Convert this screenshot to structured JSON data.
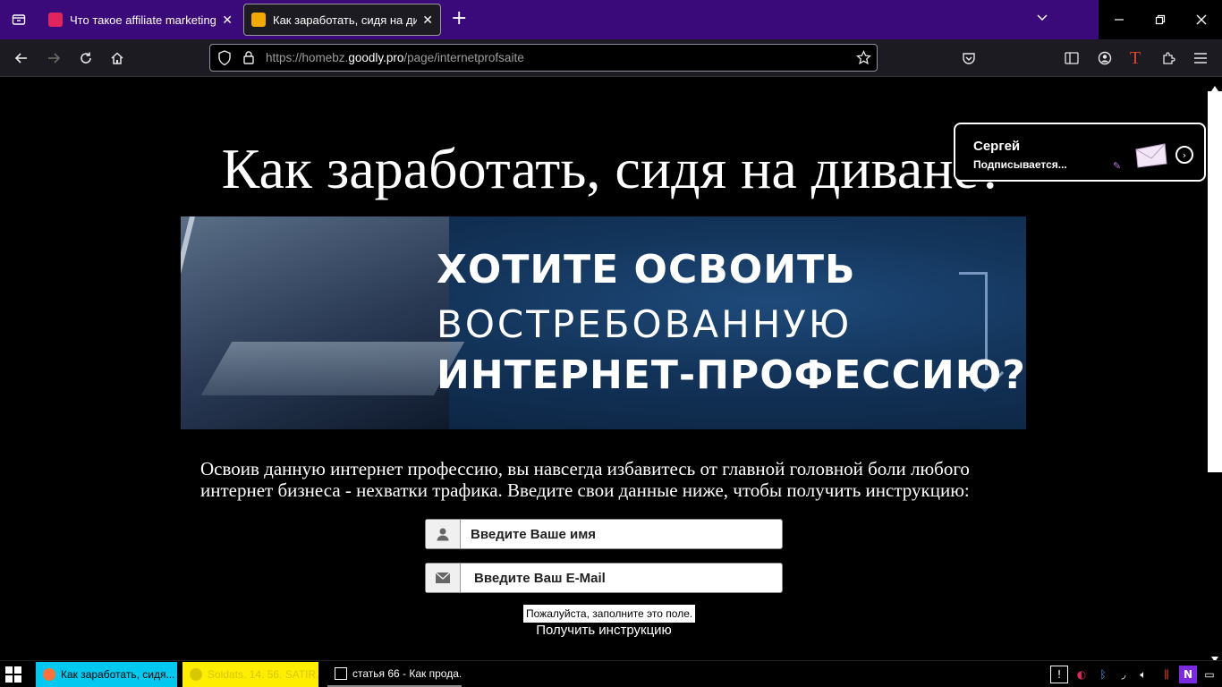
{
  "browser": {
    "tabs": [
      {
        "title": "Что такое affiliate marketing – Ц",
        "favicon_color": "#e0245e",
        "active": false
      },
      {
        "title": "Как заработать, сидя на диване?",
        "favicon_color": "#f2a900",
        "active": true
      }
    ],
    "url_prefix": "https://homebz.",
    "url_domain": "goodly.pro",
    "url_path": "/page/internetprofsaite"
  },
  "page": {
    "heading": "Как заработать, сидя на диване?",
    "banner": {
      "line1": "ХОТИТЕ ОСВОИТЬ",
      "line2": "ВОСТРЕБОВАННУЮ",
      "line3": "ИНТЕРНЕТ-ПРОФЕССИЮ?"
    },
    "description": "Освоив данную интернет профессию, вы навсегда избавитесь от главной головной боли любого интернет бизнеса - нехватки трафика. Введите свои данные ниже, чтобы получить инструкцию:",
    "form": {
      "name_placeholder": "Введите Ваше имя",
      "email_placeholder": "Введите Ваш E-Mail",
      "validation_tooltip": "Пожалуйста, заполните это поле.",
      "submit_label": "Получить инструкцию"
    }
  },
  "notification": {
    "name": "Сергей",
    "status": "Подписывается..."
  },
  "taskbar": {
    "items": [
      {
        "label": "Как заработать, сидя...",
        "color": "#00c8ee"
      },
      {
        "label": "Soldats. 14. 56. SATIR...",
        "color": "#ffee00"
      },
      {
        "label": "статья 66 - Как прода...",
        "color": "#000000"
      }
    ]
  }
}
